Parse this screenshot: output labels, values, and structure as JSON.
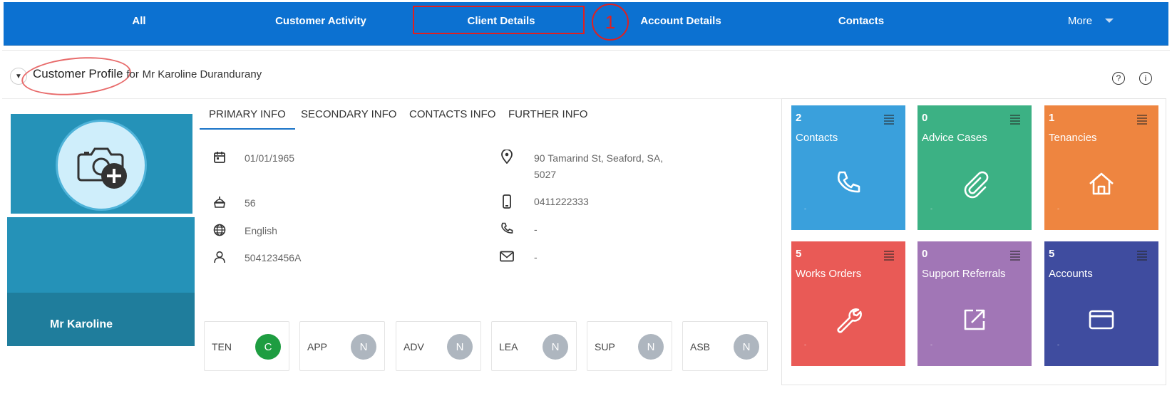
{
  "nav": {
    "items": [
      "All",
      "Customer Activity",
      "Client Details",
      "Account Details",
      "Contacts"
    ],
    "more_label": "More",
    "annotation_number": "1"
  },
  "header": {
    "title": "Customer Profile",
    "for_text": "for",
    "customer_name": "Mr Karoline Durandurany",
    "help_icon": "?",
    "info_icon": "i"
  },
  "profile": {
    "display_name": "Mr  Karoline"
  },
  "tabs": [
    "PRIMARY INFO",
    "SECONDARY INFO",
    "CONTACTS INFO",
    "FURTHER INFO"
  ],
  "primary_info": {
    "dob": "01/01/1965",
    "age": "56",
    "language": "English",
    "customer_id": "504123456A",
    "address_line1": "90 Tamarind St, Seaford, SA,",
    "address_line2": "5027",
    "mobile": "0411222333",
    "phone": "-",
    "email": "-"
  },
  "flags": [
    {
      "label": "TEN",
      "status": "C",
      "color": "#1e9d41"
    },
    {
      "label": "APP",
      "status": "N",
      "color": "#aeb6bf"
    },
    {
      "label": "ADV",
      "status": "N",
      "color": "#aeb6bf"
    },
    {
      "label": "LEA",
      "status": "N",
      "color": "#aeb6bf"
    },
    {
      "label": "SUP",
      "status": "N",
      "color": "#aeb6bf"
    },
    {
      "label": "ASB",
      "status": "N",
      "color": "#aeb6bf"
    }
  ],
  "tiles": [
    {
      "count": "2",
      "label": "Contacts",
      "color": "#3aa0dc",
      "icon": "phone-icon",
      "footer": "-"
    },
    {
      "count": "0",
      "label": "Advice Cases",
      "color": "#3cb184",
      "icon": "paperclip-icon",
      "footer": "-"
    },
    {
      "count": "1",
      "label": "Tenancies",
      "color": "#ee8540",
      "icon": "home-icon",
      "footer": "-"
    },
    {
      "count": "5",
      "label": "Works Orders",
      "color": "#e95a56",
      "icon": "wrench-icon",
      "footer": "-"
    },
    {
      "count": "0",
      "label": "Support Referrals",
      "color": "#a176b6",
      "icon": "external-link-icon",
      "footer": "-"
    },
    {
      "count": "5",
      "label": "Accounts",
      "color": "#3f4c9f",
      "icon": "credit-card-icon",
      "footer": "-"
    }
  ]
}
